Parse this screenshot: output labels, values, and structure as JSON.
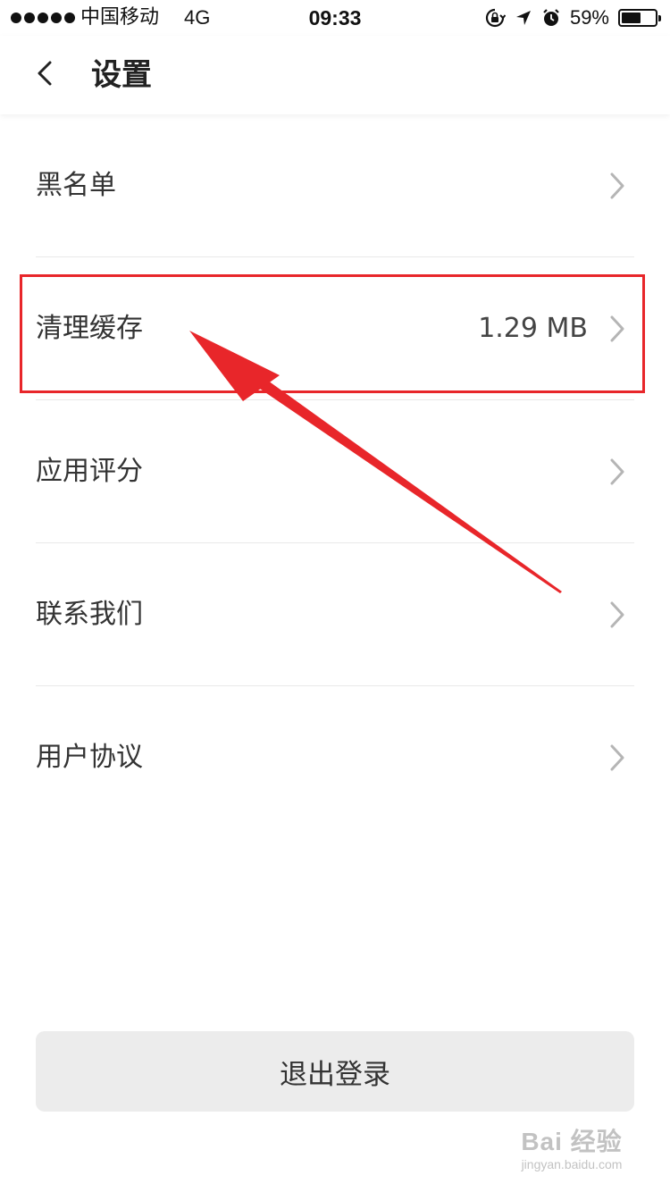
{
  "status_bar": {
    "carrier": "中国移动",
    "network": "4G",
    "time": "09:33",
    "battery_percent": "59%",
    "battery_level": 0.59,
    "icons": [
      "signal-dots-icon",
      "rotation-lock-icon",
      "location-arrow-icon",
      "alarm-clock-icon",
      "battery-icon"
    ]
  },
  "nav": {
    "back_icon": "chevron-left-icon",
    "title": "设置"
  },
  "settings": {
    "items": [
      {
        "label": "黑名单",
        "value": ""
      },
      {
        "label": "清理缓存",
        "value": "1.29 MB"
      },
      {
        "label": "应用评分",
        "value": ""
      },
      {
        "label": "联系我们",
        "value": ""
      },
      {
        "label": "用户协议",
        "value": ""
      }
    ]
  },
  "actions": {
    "logout_label": "退出登录"
  },
  "watermark": {
    "logo": "Bai 经验",
    "url": "jingyan.baidu.com"
  },
  "colors": {
    "annotation_red": "#e8262a",
    "logout_bg": "#ececec",
    "chevron": "#b5b5b5"
  }
}
